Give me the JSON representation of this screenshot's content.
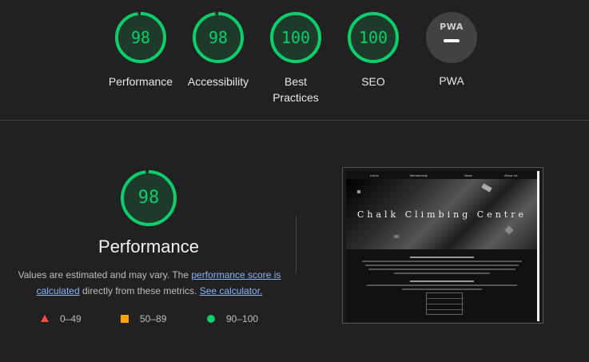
{
  "colors": {
    "pass": "#0cce6b",
    "average": "#ffa400",
    "fail": "#ff4e42",
    "ring_bg": "#1e3a2a"
  },
  "categories": [
    {
      "label": "Performance",
      "score": 98
    },
    {
      "label": "Accessibility",
      "score": 98
    },
    {
      "label": "Best Practices",
      "score": 100
    },
    {
      "label": "SEO",
      "score": 100
    }
  ],
  "pwa": {
    "badge": "PWA",
    "label": "PWA"
  },
  "main": {
    "score": 98,
    "title": "Performance",
    "desc_prefix": "Values are estimated and may vary. The ",
    "link_score": "performance score is calculated",
    "desc_middle": " directly from these metrics. ",
    "link_calc": "See calculator."
  },
  "legend": [
    {
      "icon": "triangle-icon",
      "range": "0–49"
    },
    {
      "icon": "square-icon",
      "range": "50–89"
    },
    {
      "icon": "circle-icon",
      "range": "90–100"
    }
  ],
  "thumbnail": {
    "nav": [
      "Home",
      "Membership",
      "News",
      "About Us"
    ],
    "hero_title": "Chalk Climbing Centre"
  }
}
